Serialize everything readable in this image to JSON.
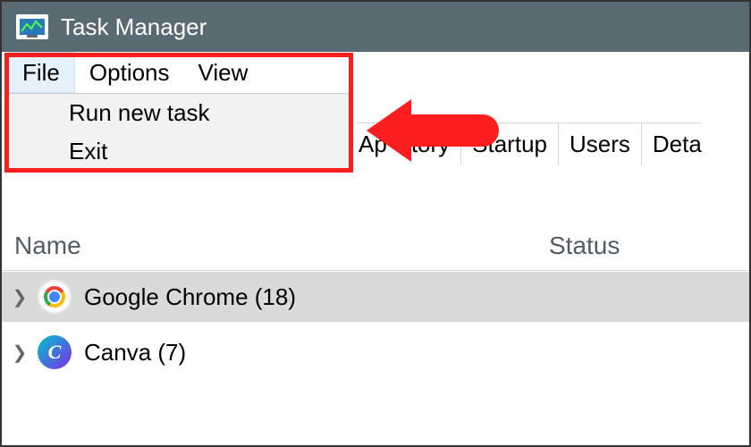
{
  "titlebar": {
    "title": "Task Manager"
  },
  "menubar": {
    "items": [
      {
        "label": "File",
        "open": true
      },
      {
        "label": "Options",
        "open": false
      },
      {
        "label": "View",
        "open": false
      }
    ]
  },
  "file_dropdown": {
    "items": [
      {
        "label": "Run new task"
      },
      {
        "label": "Exit"
      }
    ]
  },
  "tabs": {
    "partial_left_1": "Ap",
    "partial_left_2": "story",
    "items": [
      {
        "label": "Startup"
      },
      {
        "label": "Users"
      }
    ],
    "partial_right": "Deta"
  },
  "columns": {
    "name": "Name",
    "status": "Status"
  },
  "processes": [
    {
      "name": "Google Chrome (18)",
      "icon": "chrome"
    },
    {
      "name": "Canva (7)",
      "icon": "canva"
    }
  ],
  "canva_glyph": "C"
}
